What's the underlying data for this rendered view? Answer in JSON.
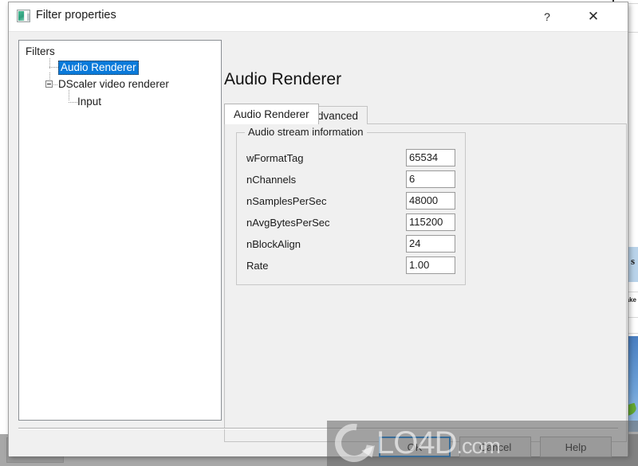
{
  "window": {
    "title": "Filter properties",
    "icon": "filter-properties-icon",
    "help_label": "?",
    "close_label": "✕"
  },
  "tree": {
    "root_label": "Filters",
    "nodes": [
      {
        "label": "Audio Renderer",
        "selected": true
      },
      {
        "label": "DScaler video renderer",
        "selected": false
      },
      {
        "label": "Input",
        "selected": false
      }
    ]
  },
  "content": {
    "title": "Audio Renderer",
    "tabs": [
      {
        "label": "Audio Renderer",
        "active": true
      },
      {
        "label": "Advanced",
        "active": false
      }
    ],
    "group": {
      "legend": "Audio stream information",
      "fields": [
        {
          "label": "wFormatTag",
          "value": "65534"
        },
        {
          "label": "nChannels",
          "value": "6"
        },
        {
          "label": "nSamplesPerSec",
          "value": "48000"
        },
        {
          "label": "nAvgBytesPerSec",
          "value": "115200"
        },
        {
          "label": "nBlockAlign",
          "value": "24"
        },
        {
          "label": "Rate",
          "value": "1.00"
        }
      ]
    }
  },
  "buttons": {
    "ok": "OK",
    "cancel": "Cancel",
    "help": "Help"
  },
  "watermark": {
    "text": "LO4D",
    "suffix": ".com"
  },
  "background": {
    "snippet_letter": "s",
    "snippet_small": "ake"
  },
  "colors": {
    "selection_blue": "#0a7ada",
    "focus_border_blue": "#0a7ada",
    "dialog_face": "#f0f0f0",
    "field_white": "#ffffff"
  }
}
